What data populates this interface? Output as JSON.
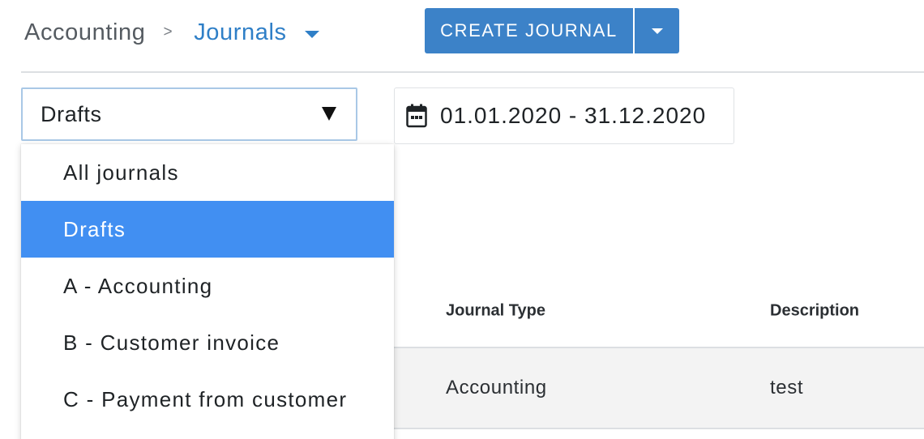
{
  "breadcrumb": {
    "root": "Accounting",
    "separator": ">",
    "current": "Journals"
  },
  "toolbar": {
    "create_label": "CREATE JOURNAL"
  },
  "filter": {
    "selected": "Drafts",
    "options": [
      {
        "label": "All journals",
        "selected": false
      },
      {
        "label": "Drafts",
        "selected": true
      },
      {
        "label": "A - Accounting",
        "selected": false
      },
      {
        "label": "B - Customer invoice",
        "selected": false
      },
      {
        "label": "C - Payment from customer",
        "selected": false
      }
    ]
  },
  "date_range": {
    "value": "01.01.2020 - 31.12.2020",
    "icon": "calendar-icon"
  },
  "table": {
    "headers": {
      "journal_type": "Journal Type",
      "description": "Description"
    },
    "rows": [
      {
        "journal_type": "Accounting",
        "description": "test"
      }
    ]
  },
  "colors": {
    "accent": "#3c82c8",
    "link": "#2f7fc7",
    "selected_option": "#418ff2"
  }
}
